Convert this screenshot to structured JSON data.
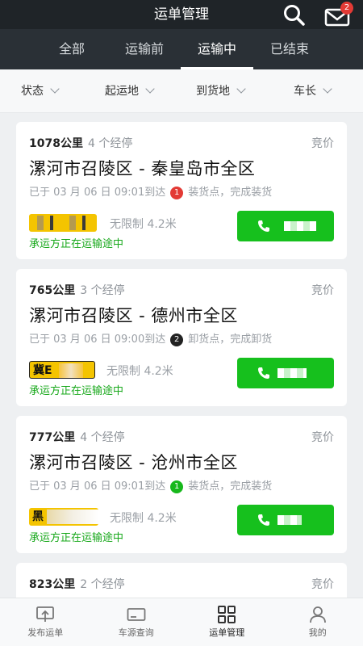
{
  "header": {
    "title": "运单管理",
    "mail_badge": "2"
  },
  "tabs": [
    {
      "label": "全部"
    },
    {
      "label": "运输前"
    },
    {
      "label": "运输中"
    },
    {
      "label": "已结束"
    }
  ],
  "active_tab": "运输中",
  "filters": [
    {
      "label": "状态"
    },
    {
      "label": "起运地"
    },
    {
      "label": "到货地"
    },
    {
      "label": "车长"
    }
  ],
  "orders": [
    {
      "distance": "1078公里",
      "stops": "4 个经停",
      "bid": "竞价",
      "route": "漯河市召陵区 - 秦皇岛市全区",
      "arrival": "已于 03 月 06 日 09:01到达",
      "point_num": "1",
      "point_color": "#e33a35",
      "point_status": "装货点，完成装货",
      "plate_text": "",
      "vehicle": "无限制 4.2米",
      "carrier_status": "承运方正在运输途中"
    },
    {
      "distance": "765公里",
      "stops": "3 个经停",
      "bid": "竞价",
      "route": "漯河市召陵区 - 德州市全区",
      "arrival": "已于 03 月 06 日 09:00到达",
      "point_num": "2",
      "point_color": "#222222",
      "point_status": "卸货点，完成卸货",
      "plate_text": "冀E    5",
      "vehicle": "无限制 4.2米",
      "carrier_status": "承运方正在运输途中"
    },
    {
      "distance": "777公里",
      "stops": "4 个经停",
      "bid": "竞价",
      "route": "漯河市召陵区 - 沧州市全区",
      "arrival": "已于 03 月 06 日 09:01到达",
      "point_num": "1",
      "point_color": "#17b81c",
      "point_status": "装货点，完成装货",
      "plate_text": "黑",
      "vehicle": "无限制 4.2米",
      "carrier_status": "承运方正在运输途中"
    },
    {
      "distance": "823公里",
      "stops": "2 个经停",
      "bid": "竞价"
    }
  ],
  "bottom_nav": [
    {
      "label": "发布运单",
      "icon": "publish-icon"
    },
    {
      "label": "车源查询",
      "icon": "vehicle-search-icon"
    },
    {
      "label": "运单管理",
      "icon": "grid-icon"
    },
    {
      "label": "我的",
      "icon": "user-icon"
    }
  ],
  "colors": {
    "accent_green": "#16c01d",
    "header_bg": "#1f2428",
    "tabs_bg": "#2a3036"
  }
}
